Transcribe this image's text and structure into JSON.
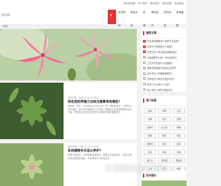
{
  "top_links": [
    "添加到收藏",
    "关于我们",
    "联系我们",
    "网站地图",
    "留言建议"
  ],
  "logo": "花卉网",
  "nav": [
    {
      "label": "首页",
      "active": true
    },
    {
      "label": "花卉知识"
    },
    {
      "label": "养花大全"
    },
    {
      "label": "花语"
    },
    {
      "label": "养花技巧"
    },
    {
      "label": "花卉动态"
    },
    {
      "label": "多肉植物"
    }
  ],
  "breadcrumb": "⌂ 首页",
  "articles": [
    {
      "meta": "发布日期：2025-07-15 11:33:23",
      "title": "鸡毛菜的养殖方法和注意事项有哪些？",
      "excerpt": "鸡毛菜（学名：Schefflera arboricola）是一种常绿灌木，以其叶片形状独特、易于养护而受到人们喜爱。如果你正在考虑种植鸡毛菜，下面一些养殖方法和注意事项可以帮助你更好地照顾它。"
    },
    {
      "meta": "发布日期：2025-07-15 11:30:40",
      "title": "多肉植物冬天怎么养护？",
      "excerpt": "冬季气温较低，多肉植物容易受冻。需要注意控制浇水、增加光照，并保持适宜的温度，才能帮助它们安全过冬。"
    }
  ],
  "sidebar": {
    "recommend_title": "推荐文章",
    "recommend": [
      "冬天多肉植物怎么养护才不会死？",
      "红掌叶子发黄是什么原因？",
      "富贵竹怎么养才能长得更旺盛？",
      "水培绿萝多久换一次水比较好？",
      "兰花不开花是什么原因呢？",
      "茉莉花的种植方法和注意事项",
      "牡丹花什么时候种植最好？",
      "月季花怎么修剪才能多开花？",
      "怀孕了可以养什么花卉？",
      "仙人掌怎么养护才能开花？"
    ],
    "hot_tags_title": "热门标签",
    "hot_tags": [
      "多肉",
      "绿萝",
      "兰花",
      "月季",
      "牡丹",
      "茉莉",
      "富贵竹",
      "仙人掌",
      "杨梅",
      "玫瑰",
      "桂花",
      "荷花",
      "发财树",
      "菊花",
      "桃花",
      "红掌",
      "水仙",
      "百合",
      "君子兰",
      "满天星",
      "郁金香",
      "绿植",
      "盆景",
      "樱花"
    ],
    "photo_title": "花卉图片"
  },
  "watermark": "欢迎网站征求网址…"
}
